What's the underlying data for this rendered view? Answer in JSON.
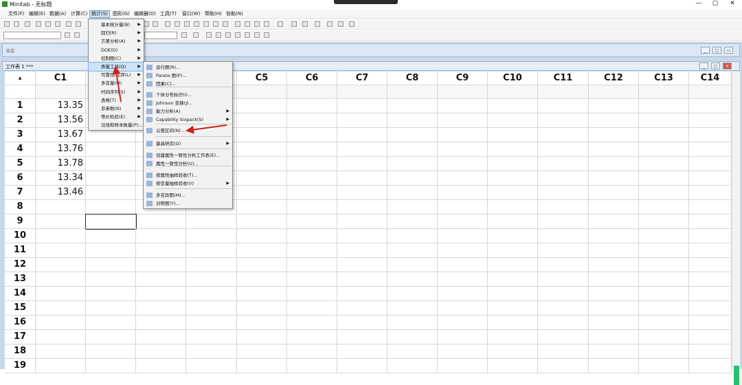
{
  "window": {
    "title": "Minitab - 无标题"
  },
  "menubar": [
    "文件(F)",
    "编辑(E)",
    "数据(A)",
    "计算(C)",
    "统计(S)",
    "图形(G)",
    "编辑器(D)",
    "工具(T)",
    "窗口(W)",
    "帮助(H)",
    "协助(N)"
  ],
  "session": {
    "label": "会话"
  },
  "worksheet": {
    "title": "工作表 1 ***",
    "columns": [
      "C1",
      "C2",
      "C3",
      "C4",
      "C5",
      "C6",
      "C7",
      "C8",
      "C9",
      "C10",
      "C11",
      "C12",
      "C13",
      "C14"
    ],
    "rows": [
      "1",
      "2",
      "3",
      "4",
      "5",
      "6",
      "7",
      "8",
      "9",
      "10",
      "11",
      "12",
      "13",
      "14",
      "15",
      "16",
      "17",
      "18",
      "19"
    ],
    "c1_values": [
      "13.35",
      "13.56",
      "13.67",
      "13.76",
      "13.78",
      "13.34",
      "13.46"
    ]
  },
  "stat_menu": [
    "基本统计量(B)",
    "回归(R)",
    "方差分析(A)",
    "DOE(D)",
    "控制图(C)",
    "质量工具(Q)",
    "可靠性/生存(L)",
    "多变量(M)",
    "时间序列(S)",
    "表格(T)",
    "非参数(N)",
    "等价检验(E)",
    "功效和样本数量(P)..."
  ],
  "quality_menu": [
    "运行图(R)...",
    "Pareto 图(P)...",
    "因果(C)...",
    "个体分布标识(I)...",
    "Johnson 变换(J)...",
    "能力分析(A)",
    "Capability Sixpack(S)",
    "公差区间(N)...",
    "量具研究(G)",
    "创建属性一致性分析工作表(E)...",
    "属性一致性分析(U)...",
    "按属性抽样验收(T)...",
    "按变量抽样验收(V)",
    "多变异图(M)...",
    "对称图(Y)..."
  ],
  "colors": {
    "highlight": "#cde3f7",
    "annotation_arrow": "#d0201a",
    "mdi_bg": "#c8d8ea"
  }
}
